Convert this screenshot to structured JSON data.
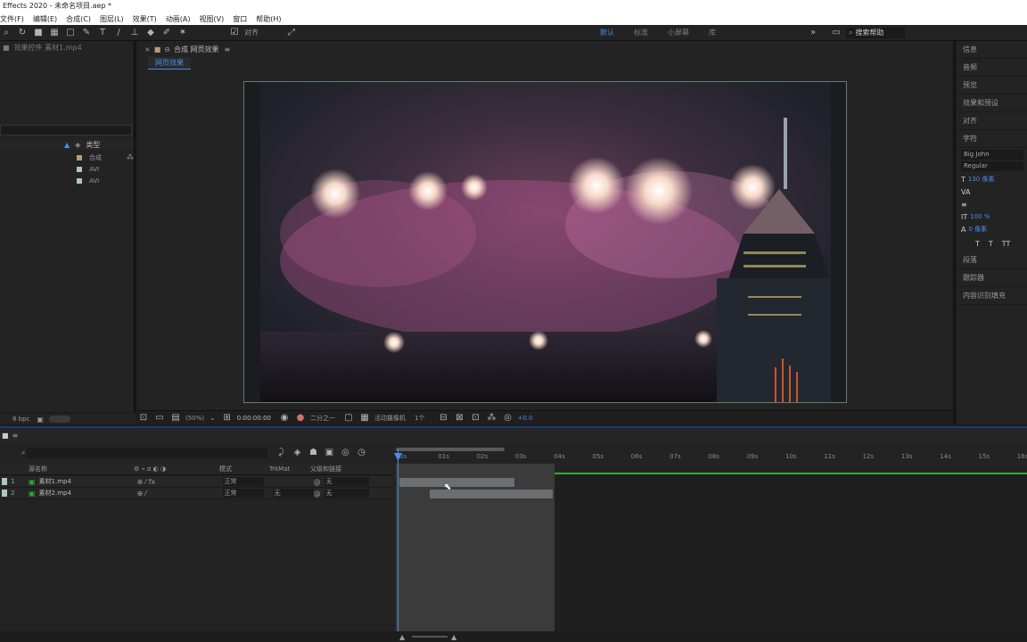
{
  "window": {
    "title": "Effects 2020 - 未命名项目.aep *"
  },
  "menu": [
    "文件(F)",
    "编辑(E)",
    "合成(C)",
    "图层(L)",
    "效果(T)",
    "动画(A)",
    "视图(V)",
    "窗口",
    "帮助(H)"
  ],
  "toolbar": {
    "snap_label": "对齐",
    "workspaces": [
      "默认",
      "标准",
      "小屏幕",
      "库"
    ],
    "search_placeholder": "搜索帮助"
  },
  "project": {
    "header": "效果控件 素材1.mp4",
    "col_type": "类型",
    "items": [
      {
        "type": "合成"
      },
      {
        "type": "AVI"
      },
      {
        "type": "AVI"
      }
    ],
    "footer_bpc": "8 bpc"
  },
  "comp": {
    "tab_label": "合成 网页效果",
    "sub_tab": "网页效果"
  },
  "viewer_bar": {
    "zoom": "(50%)",
    "timecode": "0:00:00:00",
    "resolution": "二分之一",
    "camera": "活动摄像机",
    "views": "1个",
    "exposure": "+0.0"
  },
  "right_panel": {
    "items": [
      "信息",
      "音频",
      "预览",
      "效果和预设",
      "对齐",
      "字符"
    ],
    "font": "Big John",
    "style": "Regular",
    "font_size": "130 像素",
    "leading": "100 %",
    "kerning": "0 像素",
    "lower_items": [
      "段落",
      "跟踪器",
      "内容识别填充"
    ]
  },
  "timeline": {
    "search_placeholder": "",
    "headers": {
      "source": "源名称",
      "mode": "模式",
      "trkmat": "TrkMat",
      "parent": "父级和链接"
    },
    "layers": [
      {
        "index": "1",
        "name": "素材1.mp4",
        "mode": "正常",
        "trkmat": "",
        "parent": "无"
      },
      {
        "index": "2",
        "name": "素材2.mp4",
        "mode": "正常",
        "trkmat": "无",
        "parent": "无"
      }
    ],
    "ruler_labels": [
      "0s",
      "01s",
      "02s",
      "03s",
      "04s",
      "05s",
      "06s",
      "07s",
      "08s",
      "09s",
      "10s",
      "11s",
      "12s",
      "13s",
      "14s",
      "15s",
      "16s"
    ]
  },
  "colors": {
    "accent": "#4b8ce8",
    "panel": "#232323",
    "green": "#2fae2f"
  }
}
